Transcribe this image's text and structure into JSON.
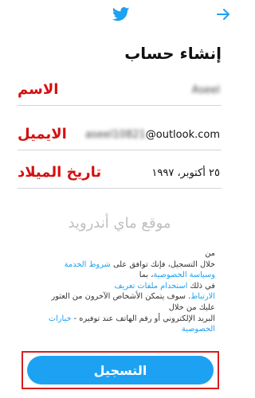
{
  "header": {
    "back_icon": "arrow-right-icon",
    "logo_icon": "twitter-bird-icon",
    "brand_color": "#1da1f2"
  },
  "title": "إنشاء حساب",
  "fields": {
    "name": {
      "label": "الاسم",
      "value": "Aseel"
    },
    "email": {
      "label": "الايميل",
      "value_blurred": "aseel10821",
      "value_domain": "@outlook.com"
    },
    "birthdate": {
      "label": "تاريخ الميلاد",
      "value": "٢٥ أكتوبر، ١٩٩٧"
    }
  },
  "watermark": "موقع ماي أندرويد",
  "terms": {
    "l1": "من",
    "l2a": "خلال التسجيل، فإنك توافق على ",
    "l2b": "شروط الخدمة",
    "l3a": "وسياسة الخصوصية",
    "l3b": "، بما",
    "l4a": "في ذلك ",
    "l4b": "استخدام ملفات تعريف",
    "l5a": "الارتباط",
    "l5b": ". سوف يتمكن الأشخاص الآخرون من العثور",
    "l6": "عليك من خلال",
    "l7a": "البريد الإلكتروني أو رقم الهاتف عند توفيره - ",
    "l7b": "خيارات",
    "l8": "الخصوصية"
  },
  "signup_button": "التسجيل",
  "highlight_color": "#d62020"
}
